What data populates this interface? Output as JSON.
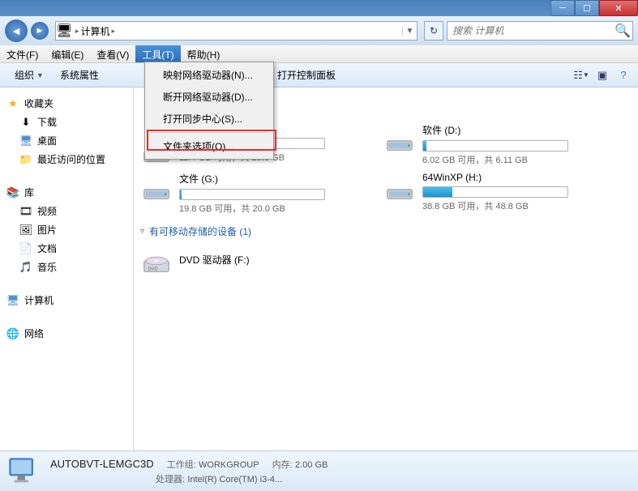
{
  "titlebar": {},
  "nav": {
    "breadcrumb_root": "计算机",
    "search_placeholder": "搜索 计算机"
  },
  "menubar": {
    "file": "文件(F)",
    "edit": "编辑(E)",
    "view": "查看(V)",
    "tools": "工具(T)",
    "help": "帮助(H)"
  },
  "dropdown": {
    "map_drive": "映射网络驱动器(N)...",
    "disconnect": "断开网络驱动器(D)...",
    "sync_center": "打开同步中心(S)...",
    "folder_options": "文件夹选项(O)..."
  },
  "toolbar": {
    "organize": "组织",
    "sys_props": "系统属性",
    "control_panel": "打开控制面板"
  },
  "sidebar": {
    "favorites": "收藏夹",
    "downloads": "下载",
    "desktop": "桌面",
    "recent": "最近访问的位置",
    "libraries": "库",
    "videos": "视频",
    "pictures": "图片",
    "documents": "文档",
    "music": "音乐",
    "computer": "计算机",
    "network": "网络"
  },
  "content": {
    "drives": [
      {
        "name": "",
        "stats": "11.4 GB 可用，共 25.0 GB",
        "fill": 54,
        "color": "blue"
      },
      {
        "name": "软件 (D:)",
        "stats": "6.02 GB 可用，共 6.11 GB",
        "fill": 2,
        "color": "blue"
      },
      {
        "name": "文件 (G:)",
        "stats": "19.8 GB 可用，共 20.0 GB",
        "fill": 1,
        "color": "blue"
      },
      {
        "name": "64WinXP   (H:)",
        "stats": "38.8 GB 可用，共 48.8 GB",
        "fill": 20,
        "color": "blue"
      }
    ],
    "removable_header": "有可移动存储的设备 (1)",
    "dvd": "DVD 驱动器 (F:)"
  },
  "status": {
    "name": "AUTOBVT-LEMGC3D",
    "workgroup_label": "工作组:",
    "workgroup": "WORKGROUP",
    "mem_label": "内存:",
    "mem": "2.00 GB",
    "cpu_label": "处理器:",
    "cpu": "Intel(R) Core(TM) i3-4..."
  }
}
